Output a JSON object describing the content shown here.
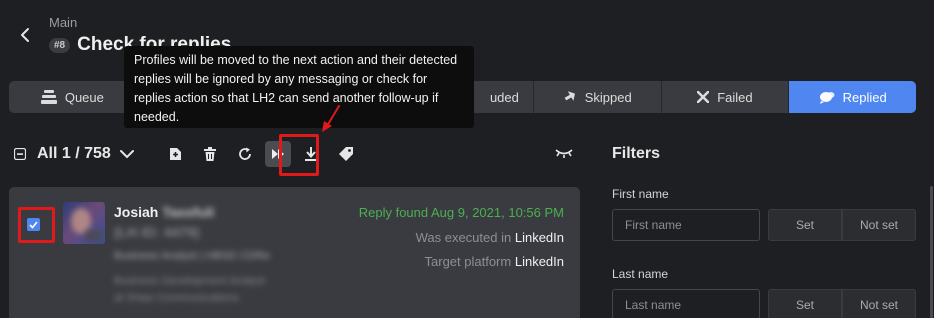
{
  "header": {
    "breadcrumb": "Main",
    "badge": "#8",
    "title": "Check for replies"
  },
  "tabs": [
    {
      "label": "Queue",
      "icon": "queue-icon",
      "active": false
    },
    {
      "label": "",
      "icon": "",
      "active": false
    },
    {
      "label": "",
      "icon": "",
      "active": false
    },
    {
      "label": "uded",
      "icon": "",
      "active": false
    },
    {
      "label": "Skipped",
      "icon": "skip-icon",
      "active": false
    },
    {
      "label": "Failed",
      "icon": "x-icon",
      "active": false
    },
    {
      "label": "Replied",
      "icon": "chat-bubble-icon",
      "active": true
    }
  ],
  "tooltip": {
    "text": "Profiles will be moved to the next action and their detected replies will be ignored by any messaging or check for replies action so that LH2 can send another follow-up if needed."
  },
  "toolbar": {
    "count_label": "All 1 / 758"
  },
  "profile": {
    "first_name": "Josiah",
    "last_name": "Tassfuli",
    "lh_id": "(LH ID: 4479)",
    "headline": "Business Analyst | HBSD CDRe",
    "company_line1": "Business Development Analyst",
    "company_line2": "at Shaw Communications",
    "reply_status": "Reply found Aug 9, 2021, 10:56 PM",
    "executed_prefix": "Was executed in",
    "executed_value": "LinkedIn",
    "target_prefix": "Target platform",
    "target_value": "LinkedIn"
  },
  "filters": {
    "title": "Filters",
    "first_name_label": "First name",
    "first_name_placeholder": "First name",
    "last_name_label": "Last name",
    "last_name_placeholder": "Last name",
    "set_label": "Set",
    "not_set_label": "Not set"
  },
  "colors": {
    "accent": "#4f86f0",
    "highlight": "#e0191b",
    "success": "#4caf50"
  }
}
